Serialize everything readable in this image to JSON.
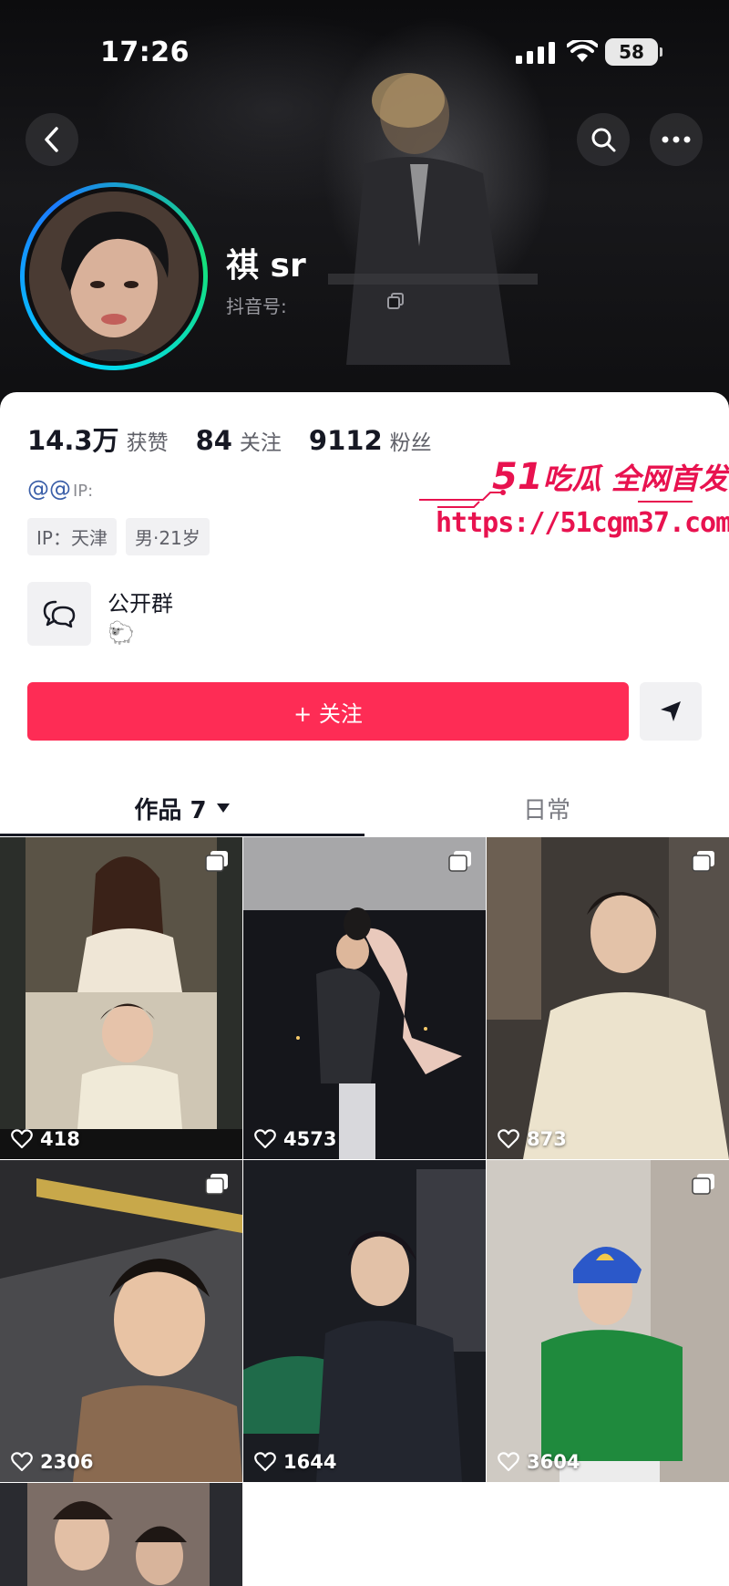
{
  "status_bar": {
    "time": "17:26",
    "battery": "58"
  },
  "profile": {
    "nickname": "祺 sr",
    "douyin_id_label": "抖音号:",
    "handle": "@@",
    "handle_ip": "IP:",
    "tags": [
      "IP：天津",
      "男·21岁"
    ]
  },
  "stats": [
    {
      "value": "14.3万",
      "label": "获赞"
    },
    {
      "value": "84",
      "label": "关注"
    },
    {
      "value": "9112",
      "label": "粉丝"
    }
  ],
  "group": {
    "title": "公开群",
    "emoji": "🐑"
  },
  "actions": {
    "follow_label": "+ 关注"
  },
  "tabs": {
    "works": "作品 7",
    "daily": "日常"
  },
  "posts": [
    {
      "likes": "418"
    },
    {
      "likes": "4573"
    },
    {
      "likes": "873"
    },
    {
      "likes": "2306"
    },
    {
      "likes": "1644"
    },
    {
      "likes": "3604"
    },
    {
      "likes": ""
    }
  ],
  "watermark": {
    "brand_num": "51",
    "brand_text": "吃瓜 全网首发",
    "url": "https://51cgm37.com"
  },
  "colors": {
    "accent": "#fe2c55",
    "watermark": "#e8124f"
  }
}
